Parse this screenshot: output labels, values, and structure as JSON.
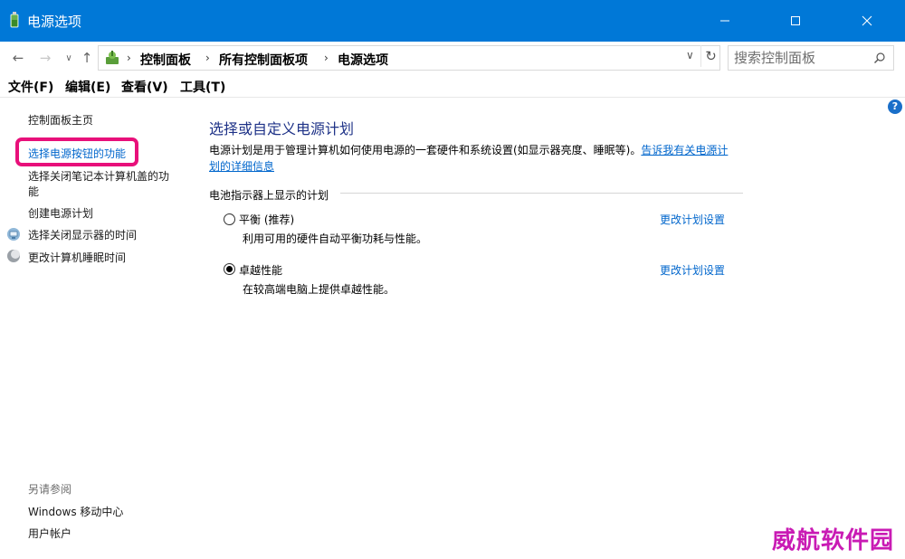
{
  "window": {
    "title": "电源选项",
    "controls": {
      "minimize": "minimize",
      "maximize": "maximize",
      "close": "close"
    }
  },
  "nav": {
    "back": "←",
    "forward": "→",
    "recent": "∨",
    "up": "↑",
    "breadcrumb": [
      "控制面板",
      "所有控制面板项",
      "电源选项"
    ],
    "separator": "›",
    "dropdown": "∨",
    "refresh": "↻",
    "search_placeholder": "搜索控制面板"
  },
  "menu": {
    "file": "文件(F)",
    "edit": "编辑(E)",
    "view": "查看(V)",
    "tools": "工具(T)"
  },
  "help": "?",
  "left_pane": {
    "home": "控制面板主页",
    "power_button": "选择电源按钮的功能",
    "lid_line1": "选择关闭笔记本计算机盖的功",
    "lid_line2": "能",
    "create_plan": "创建电源计划",
    "display_off": "选择关闭显示器的时间",
    "sleep_time": "更改计算机睡眠时间",
    "see_also": "另请参阅",
    "mobility_center": "Windows 移动中心",
    "user_accounts": "用户帐户"
  },
  "main": {
    "title": "选择或自定义电源计划",
    "description": "电源计划是用于管理计算机如何使用电源的一套硬件和系统设置(如显示器亮度、睡眠等)。",
    "more_info_link_line1": "告诉我有关电源计",
    "more_info_link_line2": "划的详细信息",
    "group_header": "电池指示器上显示的计划",
    "plans": [
      {
        "name": "平衡 (推荐)",
        "description": "利用可用的硬件自动平衡功耗与性能。",
        "link": "更改计划设置",
        "selected": false
      },
      {
        "name": "卓越性能",
        "description": "在较高端电脑上提供卓越性能。",
        "link": "更改计划设置",
        "selected": true
      }
    ]
  },
  "watermark": "威航软件园",
  "colors": {
    "titlebar": "#0078d7",
    "link": "#0066cc",
    "heading": "#1e3287",
    "highlight": "#e8107a",
    "watermark": "#c91bb4"
  }
}
